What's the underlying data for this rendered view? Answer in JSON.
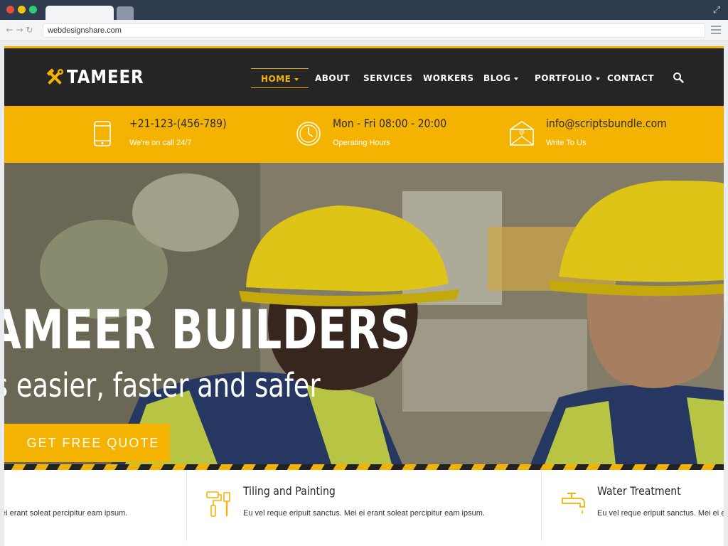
{
  "browser": {
    "url": "webdesignshare.com"
  },
  "site": {
    "logo_text": "TAMEER",
    "nav": {
      "home": "HOME",
      "about": "ABOUT",
      "services": "SERVICES",
      "workers": "WORKERS",
      "blog": "BLOG",
      "portfolio": "PORTFOLIO",
      "contact": "CONTACT"
    },
    "info": [
      {
        "title": "+21-123-(456-789)",
        "sub": "We're on call 24/7",
        "icon": "phone-icon"
      },
      {
        "title": "Mon - Fri 08:00 - 20:00",
        "sub": "Operating Hours",
        "icon": "clock-icon"
      },
      {
        "title": "info@scriptsbundle.com",
        "sub": "Write To Us",
        "icon": "envelope-icon"
      }
    ],
    "hero": {
      "title": "AMEER BUILDERS",
      "subtitle": "s easier, faster and safer",
      "cta": "GET FREE QUOTE"
    },
    "services": [
      {
        "title": "",
        "text": "ei erant soleat percipitur eam ipsum."
      },
      {
        "title": "Tiling and Painting",
        "text": "Eu vel reque eripuit sanctus. Mei ei erant soleat percipitur eam ipsum."
      },
      {
        "title": "Water Treatment",
        "text": "Eu vel reque eripuit sanctus. Mei ei er"
      }
    ]
  },
  "colors": {
    "accent": "#f5b301",
    "header_bg": "#252525"
  }
}
